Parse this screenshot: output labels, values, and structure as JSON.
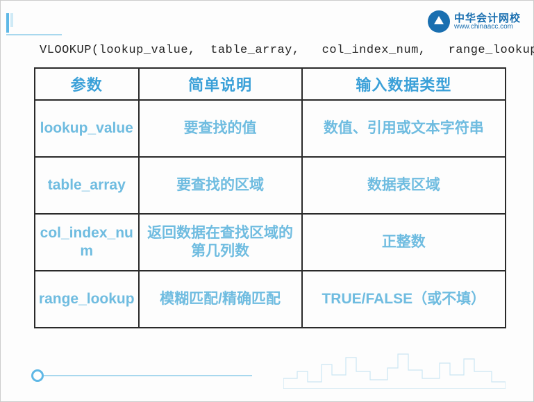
{
  "logo": {
    "cn": "中华会计网校",
    "url": "www.chinaacc.com"
  },
  "formula": "VLOOKUP(lookup_value,  table_array,   col_index_num,   range_lookup)",
  "table": {
    "headers": {
      "c1": "参数",
      "c2": "简单说明",
      "c3": "输入数据类型"
    },
    "rows": [
      {
        "param": "lookup_value",
        "desc": "要查找的值",
        "type": "数值、引用或文本字符串"
      },
      {
        "param": "table_array",
        "desc": "要查找的区域",
        "type": "数据表区域"
      },
      {
        "param": "col_index_num",
        "desc": "返回数据在查找区域的第几列数",
        "type": "正整数"
      },
      {
        "param": "range_lookup",
        "desc": "模糊匹配/精确匹配",
        "type": "TRUE/FALSE（或不填）"
      }
    ]
  }
}
